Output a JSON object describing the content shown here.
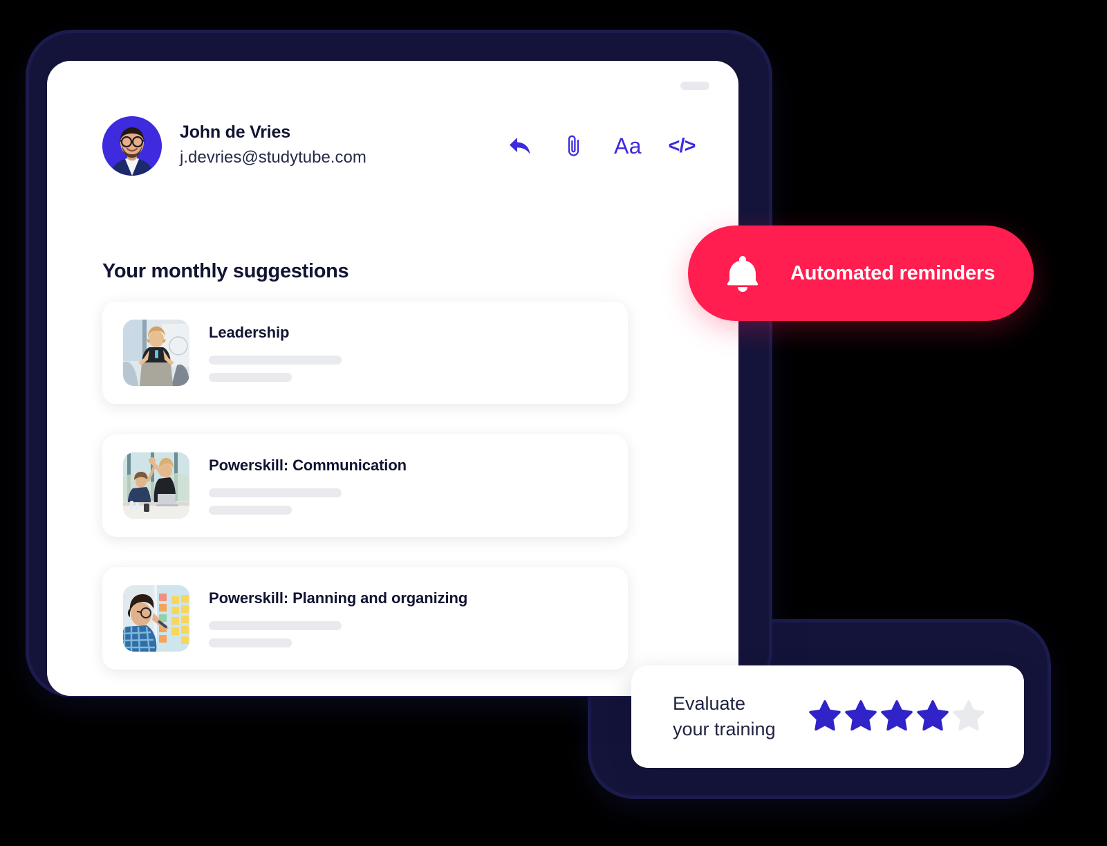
{
  "device": {
    "speaker_indicator": "speaker-pill"
  },
  "mail": {
    "sender": {
      "name": "John de Vries",
      "email": "j.devries@studytube.com",
      "avatar_bg": "#3d2bdd"
    },
    "toolbar": {
      "accent_color": "#3d2bdd",
      "items": [
        {
          "name": "reply-icon",
          "label": ""
        },
        {
          "name": "attachment-icon",
          "label": ""
        },
        {
          "name": "text-format-icon",
          "label": "Aa"
        },
        {
          "name": "code-icon",
          "label": "</>"
        }
      ]
    },
    "section_title": "Your monthly suggestions",
    "suggestions": [
      {
        "title": "Leadership",
        "thumbnail": "woman-presenting-photo"
      },
      {
        "title": "Powerskill: Communication",
        "thumbnail": "office-high-five-photo"
      },
      {
        "title": "Powerskill: Planning and organizing",
        "thumbnail": "sticky-notes-board-photo"
      }
    ],
    "placeholder_bar_color": "#e9eaee"
  },
  "reminder_badge": {
    "label": "Automated reminders",
    "icon": "bell-icon",
    "background": "#ff1e4f",
    "text_color": "#ffffff"
  },
  "rating_card": {
    "label_line1": "Evaluate",
    "label_line2": "your training",
    "rating": 4,
    "max_rating": 5,
    "filled_color": "#3023c8",
    "empty_color": "#e9eaee"
  }
}
